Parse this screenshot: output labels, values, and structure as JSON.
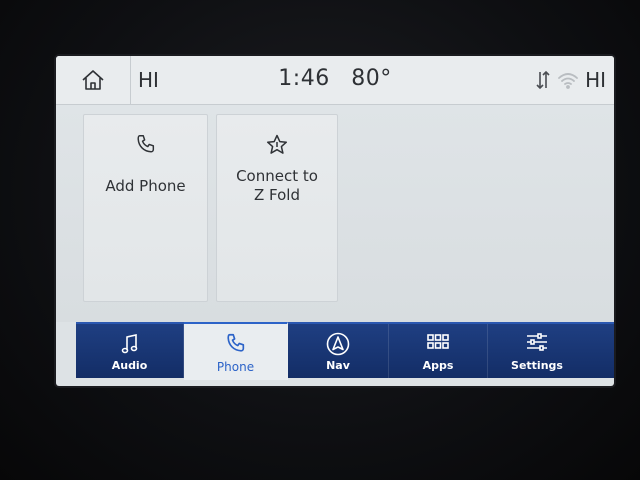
{
  "status_bar": {
    "left_label": "HI",
    "time": "1:46",
    "temperature": "80°",
    "right_label": "HI",
    "icons": [
      "home-icon",
      "data-transfer-icon",
      "wifi-icon"
    ]
  },
  "tiles": [
    {
      "icon": "phone-icon",
      "label": "Add Phone"
    },
    {
      "icon": "star-icon",
      "label_line1": "Connect to",
      "label_line2": "Z Fold"
    }
  ],
  "nav": {
    "active": "Phone",
    "items": [
      {
        "icon": "music-note-icon",
        "label": "Audio"
      },
      {
        "icon": "phone-icon",
        "label": "Phone"
      },
      {
        "icon": "navigation-arrow-icon",
        "label": "Nav"
      },
      {
        "icon": "apps-grid-icon",
        "label": "Apps"
      },
      {
        "icon": "sliders-icon",
        "label": "Settings"
      }
    ]
  },
  "colors": {
    "nav_bg": "#1a3775",
    "nav_active_bg": "#e9edf0",
    "nav_active_text": "#2c63c8",
    "screen_bg": "#dde2e5"
  }
}
